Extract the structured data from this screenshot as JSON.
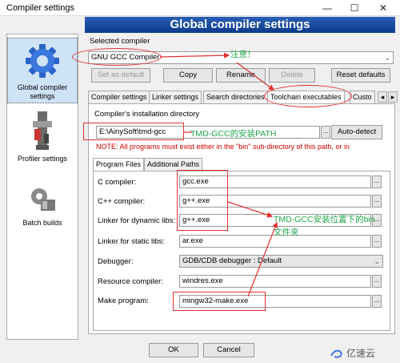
{
  "window": {
    "title": "Compiler settings",
    "banner": "Global compiler settings",
    "controls": {
      "minimize": "—",
      "maximize": "☐",
      "close": "✕"
    }
  },
  "sidebar": {
    "items": [
      {
        "label": "Global compiler settings",
        "icon": "gear-icon"
      },
      {
        "label": "Profiler settings",
        "icon": "profiler-icon"
      },
      {
        "label": "Batch builds",
        "icon": "batch-builds-icon"
      }
    ]
  },
  "compiler": {
    "selected_label": "Selected compiler",
    "selected_value": "GNU GCC Compiler",
    "buttons": {
      "set_default": "Set as default",
      "copy": "Copy",
      "rename": "Rename",
      "delete": "Delete",
      "reset": "Reset defaults"
    }
  },
  "tabs": [
    "Compiler settings",
    "Linker settings",
    "Search directories",
    "Toolchain executables",
    "Custo"
  ],
  "install": {
    "group_label": "Compiler's installation directory",
    "path": "E:\\AinySoft\\tmd-gcc",
    "autodetect": "Auto-detect",
    "dots": "...",
    "note": "NOTE: All programs must exist either in the \"bin\" sub-directory of this path, or in"
  },
  "subtabs": [
    "Program Files",
    "Additional Paths"
  ],
  "programs": [
    {
      "label": "C compiler:",
      "value": "gcc.exe"
    },
    {
      "label": "C++ compiler:",
      "value": "g++.exe"
    },
    {
      "label": "Linker for dynamic libs:",
      "value": "g++.exe"
    },
    {
      "label": "Linker for static libs:",
      "value": "ar.exe"
    },
    {
      "label": "Debugger:",
      "value": "GDB/CDB debugger : Default"
    },
    {
      "label": "Resource compiler:",
      "value": "windres.exe"
    },
    {
      "label": "Make program:",
      "value": "mingw32-make.exe"
    }
  ],
  "footer": {
    "ok": "OK",
    "cancel": "Cancel"
  },
  "annotations": {
    "note": "注意！",
    "path": "TMD-GCC的安装PATH",
    "bin_line1": "TMD-GCC安装位置下的bin",
    "bin_line2": "文件夹",
    "color_red": "#e53030",
    "color_green": "#1ea84a"
  },
  "watermark": "亿速云"
}
